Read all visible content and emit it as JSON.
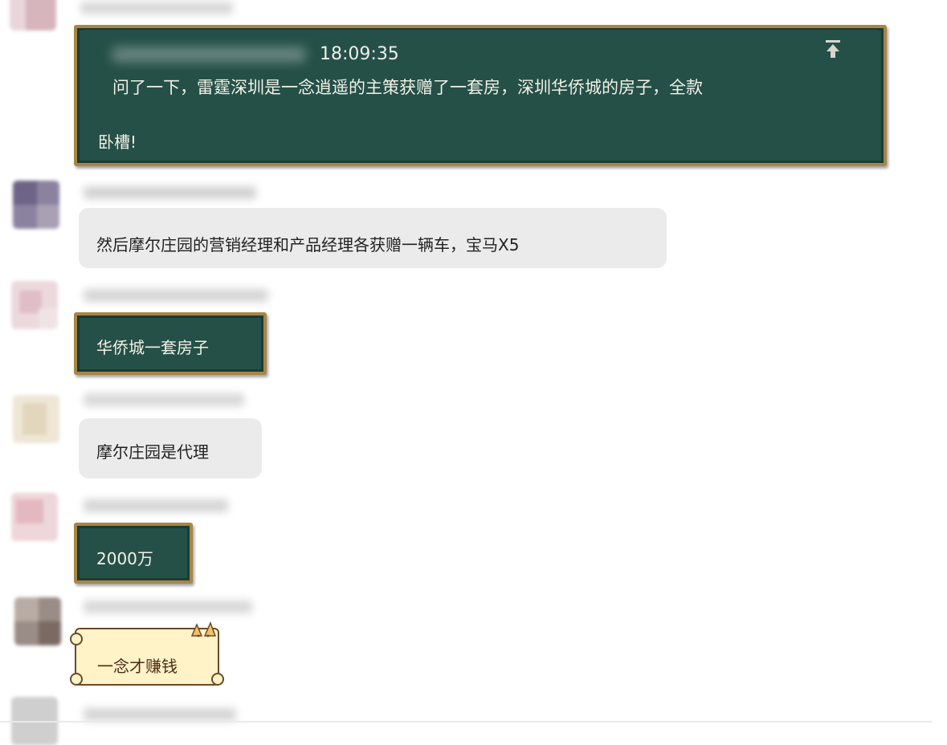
{
  "messages": [
    {
      "kind": "board",
      "time": "18:09:35",
      "text_line1": "问了一下，雷霆深圳是一念逍遥的主策获赠了一套房，深圳华侨城的房子，全款",
      "text_line2": "卧槽!"
    },
    {
      "kind": "grey",
      "text": "然后摩尔庄园的营销经理和产品经理各获赠一辆车，宝马X5"
    },
    {
      "kind": "board",
      "text": "华侨城一套房子"
    },
    {
      "kind": "grey",
      "text": "摩尔庄园是代理"
    },
    {
      "kind": "board",
      "text": "2000万"
    },
    {
      "kind": "scroll",
      "text": "一念才赚钱"
    }
  ],
  "colors": {
    "board_bg": "#245048",
    "board_frame": "#a98545",
    "grey_bubble": "#ebebeb",
    "scroll_bg": "#fff3c7"
  },
  "icons": [
    "pin-to-top-icon",
    "cat-ears-icon"
  ]
}
